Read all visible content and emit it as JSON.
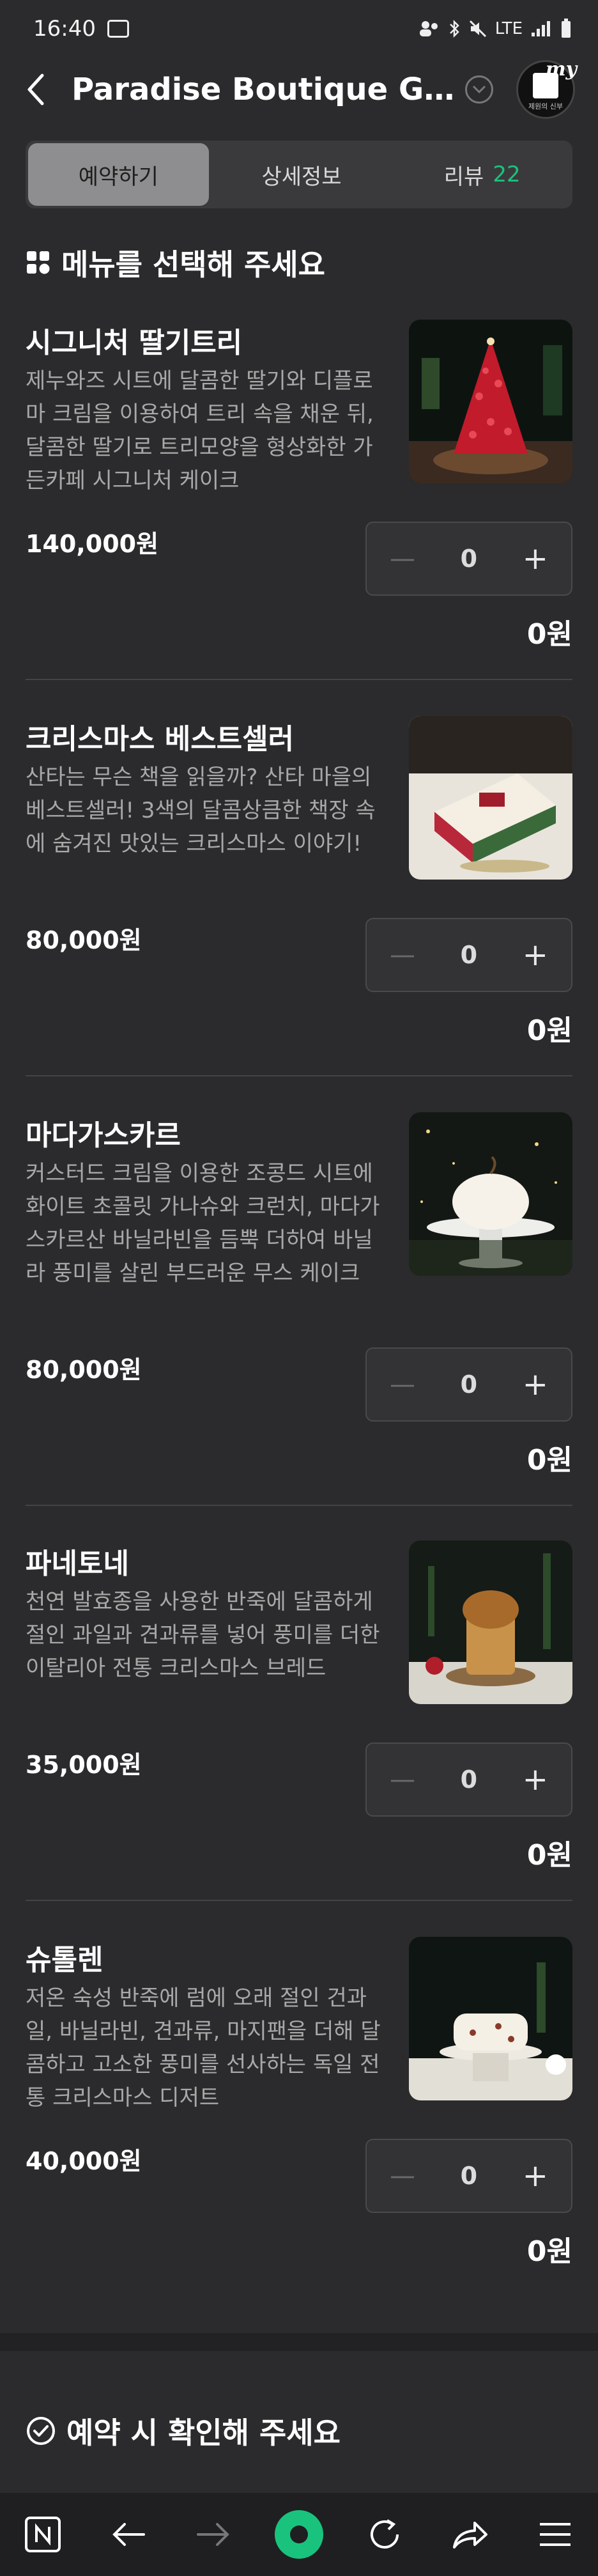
{
  "status_bar": {
    "time": "16:40",
    "network": "LTE"
  },
  "header": {
    "title": "Paradise Boutique Garde...",
    "badge_text": "my",
    "badge_caption": "제원의 신부"
  },
  "tabs": [
    {
      "label": "예약하기"
    },
    {
      "label": "상세정보"
    },
    {
      "label": "리뷰",
      "count": "22"
    }
  ],
  "section": {
    "title": "메뉴를 선택해 주세요"
  },
  "menu": [
    {
      "name": "시그니처 딸기트리",
      "description": "제누와즈 시트에 달콤한 딸기와 디플로마 크림을 이용하여 트리 속을 채운 뒤, 달콤한 딸기로 트리모양을 형상화한 가든카페 시그니처 케이크",
      "price": "140,000원",
      "quantity": "0",
      "subtotal": "0원"
    },
    {
      "name": "크리스마스 베스트셀러",
      "description": "산타는 무슨 책을 읽을까? 산타 마을의 베스트셀러! 3색의 달콤상큼한 책장 속에 숨겨진 맛있는 크리스마스 이야기!",
      "price": "80,000원",
      "quantity": "0",
      "subtotal": "0원"
    },
    {
      "name": "마다가스카르",
      "description": "커스터드 크림을 이용한 조콩드 시트에 화이트 초콜릿 가나슈와 크런치, 마다가스카르산 바닐라빈을 듬뿍 더하여 바닐라 풍미를 살린 부드러운 무스 케이크",
      "price": "80,000원",
      "quantity": "0",
      "subtotal": "0원"
    },
    {
      "name": "파네토네",
      "description": "천연 발효종을 사용한 반죽에 달콤하게 절인 과일과 견과류를 넣어 풍미를 더한 이탈리아 전통 크리스마스 브레드",
      "price": "35,000원",
      "quantity": "0",
      "subtotal": "0원"
    },
    {
      "name": "슈톨렌",
      "description": "저온 숙성 반죽에 럼에 오래 절인 건과일, 바닐라빈, 견과류, 마지팬을 더해 달콤하고 고소한 풍미를 선사하는 독일 전통 크리스마스 디저트",
      "price": "40,000원",
      "quantity": "0",
      "subtotal": "0원"
    }
  ],
  "confirm": {
    "title": "예약 시 확인해 주세요"
  },
  "stepper_symbols": {
    "minus": "—",
    "plus": "+"
  },
  "colors": {
    "background": "#2b2b2d",
    "accent_green": "#19c37d",
    "tab_active": "#8e8e90"
  }
}
